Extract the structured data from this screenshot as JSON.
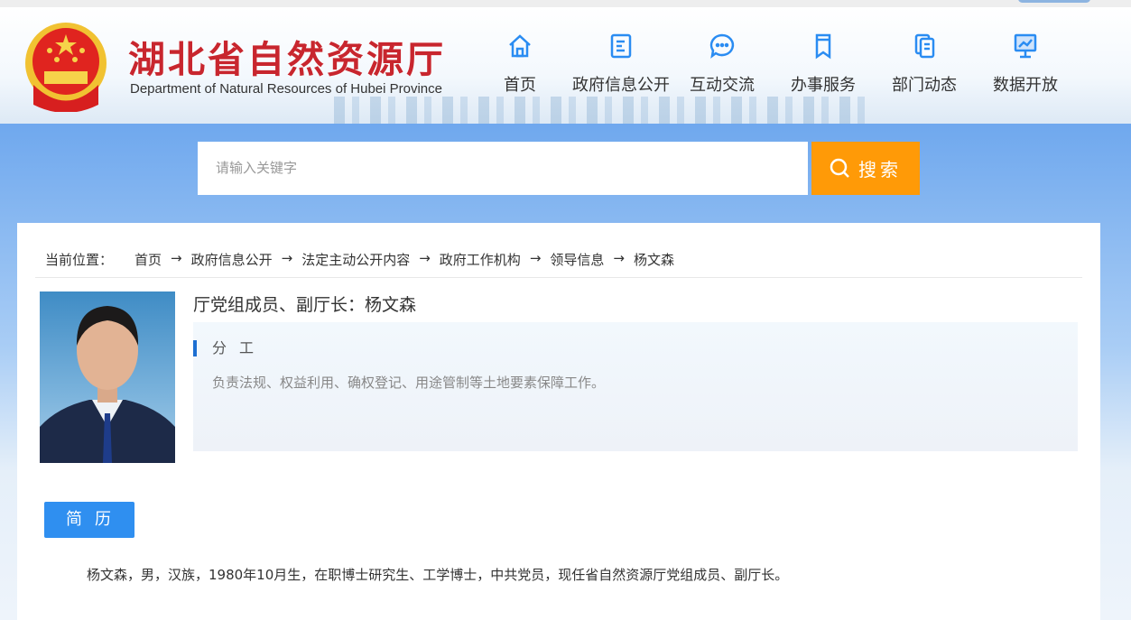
{
  "header": {
    "title": "湖北省自然资源厅",
    "subtitle": "Department of Natural Resources of Hubei Province"
  },
  "nav": [
    {
      "label": "首页",
      "icon": "home-icon"
    },
    {
      "label": "政府信息公开",
      "icon": "document-icon"
    },
    {
      "label": "互动交流",
      "icon": "chat-icon"
    },
    {
      "label": "办事服务",
      "icon": "bookmark-icon"
    },
    {
      "label": "部门动态",
      "icon": "files-icon"
    },
    {
      "label": "数据开放",
      "icon": "chart-monitor-icon"
    }
  ],
  "search": {
    "placeholder": "请输入关键字",
    "button": "搜索"
  },
  "breadcrumb": {
    "label": "当前位置：",
    "items": [
      "首页",
      "政府信息公开",
      "法定主动公开内容",
      "政府工作机构",
      "领导信息",
      "杨文森"
    ],
    "sep": "→"
  },
  "profile": {
    "title": "厅党组成员、副厅长：杨文森",
    "duty_heading": "分工",
    "duty_text": "负责法规、权益利用、确权登记、用途管制等土地要素保障工作。",
    "bio_button": "简历",
    "bio": "杨文森，男，汉族，1980年10月生，在职博士研究生、工学博士，中共党员，现任省自然资源厅党组成员、副厅长。"
  },
  "colors": {
    "accent": "#2f8ff0",
    "search_button": "#ff9a07",
    "title": "#c8262e"
  }
}
